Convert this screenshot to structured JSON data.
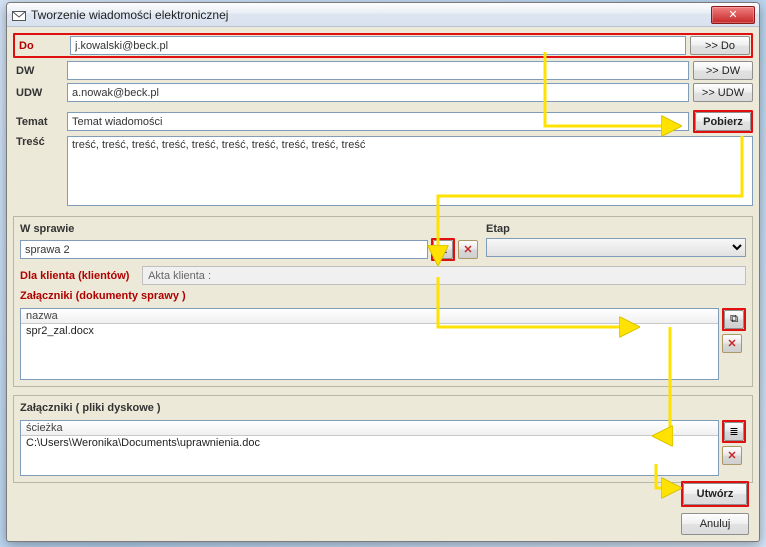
{
  "window": {
    "title": "Tworzenie wiadomości elektronicznej"
  },
  "recipients": {
    "to_label": "Do",
    "to_value": "j.kowalski@beck.pl",
    "to_btn": ">> Do",
    "cc_label": "DW",
    "cc_value": "",
    "cc_btn": ">> DW",
    "bcc_label": "UDW",
    "bcc_value": "a.nowak@beck.pl",
    "bcc_btn": ">> UDW"
  },
  "subject": {
    "label": "Temat",
    "value": "Temat wiadomości",
    "fetch_btn": "Pobierz"
  },
  "body": {
    "label": "Treść",
    "value": "treść, treść, treść, treść, treść, treść, treść, treść, treść, treść"
  },
  "case": {
    "section_label": "W sprawie",
    "value": "sprawa 2",
    "pick_btn": "...",
    "stage_label": "Etap",
    "stage_value": "",
    "for_client_label": "Dla klienta (klientów)",
    "client_placeholder": "Akta klienta :",
    "case_attachments_label": "Załączniki (dokumenty sprawy )",
    "case_att_header": "nazwa",
    "case_att_items": [
      "spr2_zal.docx"
    ]
  },
  "disk": {
    "label": "Załączniki ( pliki dyskowe )",
    "header": "ścieżka",
    "items": [
      "C:\\Users\\Weronika\\Documents\\uprawnienia.doc"
    ]
  },
  "buttons": {
    "create": "Utwórz",
    "cancel": "Anuluj"
  },
  "icons": {
    "close": "✕",
    "browse": "...",
    "delete": "✕",
    "copy": "⧉",
    "stack": "≣"
  }
}
